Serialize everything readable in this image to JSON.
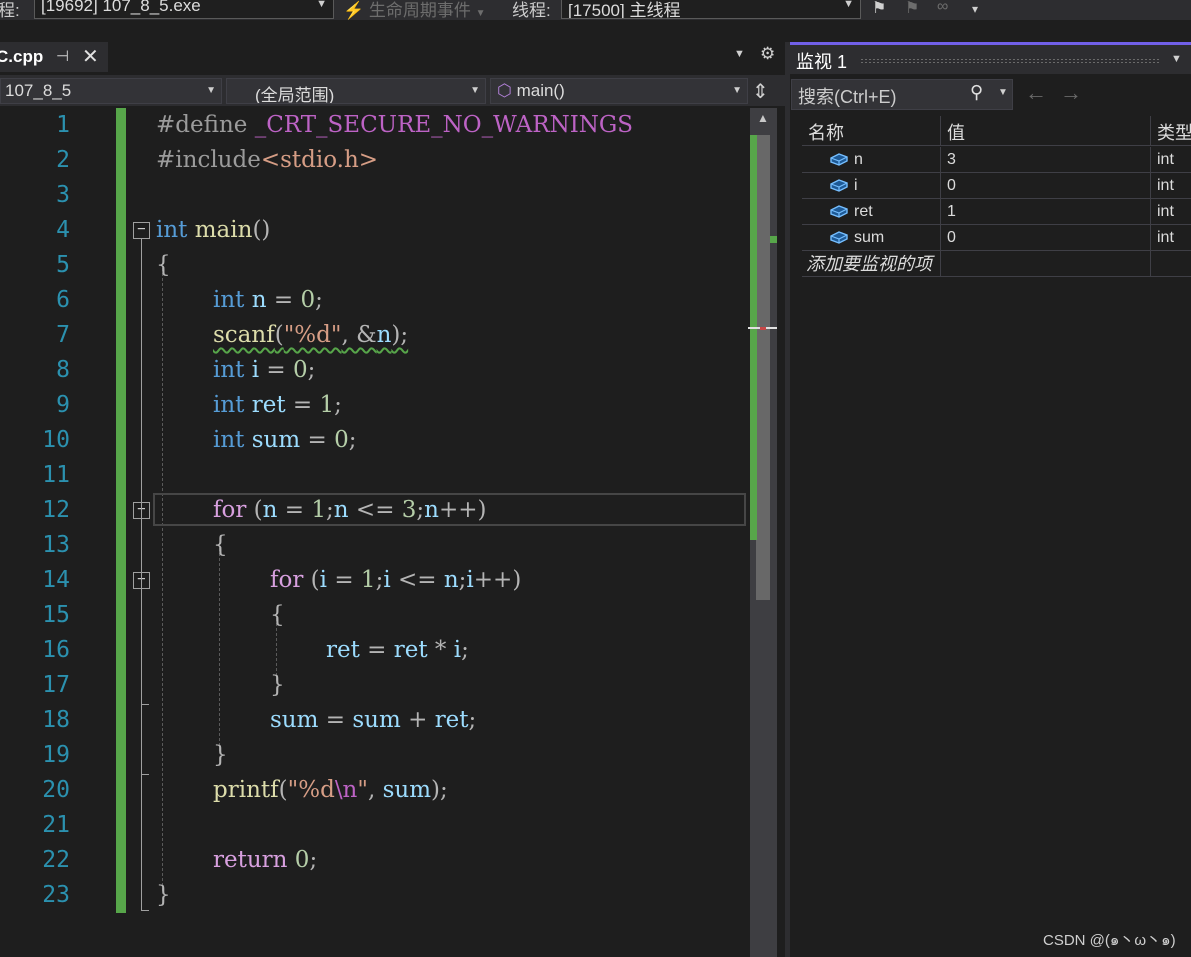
{
  "toolbar": {
    "process_label": "程:",
    "process_value": "[19692] 107_8_5.exe",
    "lifecycle_label": "生命周期事件",
    "thread_label": "线程:",
    "thread_value": "[17500] 主线程"
  },
  "editor": {
    "tab_name": "C.cpp",
    "project_scope": "107_8_5",
    "global_scope": "(全局范围)",
    "function_scope": "main()",
    "line_numbers": [
      "1",
      "2",
      "3",
      "4",
      "5",
      "6",
      "7",
      "8",
      "9",
      "10",
      "11",
      "12",
      "13",
      "14",
      "15",
      "16",
      "17",
      "18",
      "19",
      "20",
      "21",
      "22",
      "23"
    ],
    "lines": {
      "l1a": "#define ",
      "l1b": "_CRT_SECURE_NO_WARNINGS",
      "l2a": "#include",
      "l2b": "<stdio.h>",
      "l4a": "int",
      "l4b": " main",
      "l4c": "()",
      "l5": "{",
      "l6a": "int",
      "l6b": " n",
      "l6c": " = ",
      "l6d": "0",
      "l6e": ";",
      "l7a": "scanf",
      "l7b": "(",
      "l7c": "\"%d\"",
      "l7d": ", &",
      "l7e": "n",
      "l7f": ");",
      "l8a": "int",
      "l8b": " i",
      "l8c": " = ",
      "l8d": "0",
      "l8e": ";",
      "l9a": "int",
      "l9b": " ret",
      "l9c": " = ",
      "l9d": "1",
      "l9e": ";",
      "l10a": "int",
      "l10b": " sum",
      "l10c": " = ",
      "l10d": "0",
      "l10e": ";",
      "l12a": "for",
      "l12b": " (",
      "l12c": "n",
      "l12d": " = ",
      "l12e": "1",
      "l12f": ";",
      "l12g": "n",
      "l12h": " <= ",
      "l12i": "3",
      "l12j": ";",
      "l12k": "n",
      "l12l": "++)",
      "l13": "{",
      "l14a": "for",
      "l14b": " (",
      "l14c": "i",
      "l14d": " = ",
      "l14e": "1",
      "l14f": ";",
      "l14g": "i",
      "l14h": " <= ",
      "l14i": "n",
      "l14j": ";",
      "l14k": "i",
      "l14l": "++)",
      "l15": "{",
      "l16a": "ret",
      "l16b": " = ",
      "l16c": "ret",
      "l16d": " * ",
      "l16e": "i",
      "l16f": ";",
      "l17": "}",
      "l18a": "sum",
      "l18b": " = ",
      "l18c": "sum",
      "l18d": " + ",
      "l18e": "ret",
      "l18f": ";",
      "l19": "}",
      "l20a": "printf",
      "l20b": "(",
      "l20c": "\"%d",
      "l20d": "\\n",
      "l20e": "\"",
      "l20f": ", ",
      "l20g": "sum",
      "l20h": ");",
      "l22a": "return",
      "l22b": " ",
      "l22c": "0",
      "l22d": ";",
      "l23": "}"
    }
  },
  "watch": {
    "title": "监视 1",
    "search_placeholder": "搜索(Ctrl+E)",
    "columns": [
      "名称",
      "值",
      "类型"
    ],
    "rows": [
      {
        "name": "n",
        "value": "3",
        "type": "int"
      },
      {
        "name": "i",
        "value": "0",
        "type": "int"
      },
      {
        "name": "ret",
        "value": "1",
        "type": "int"
      },
      {
        "name": "sum",
        "value": "0",
        "type": "int"
      }
    ],
    "add_item": "添加要监视的项"
  },
  "watermark": "CSDN @(๑丶ω丶๑)",
  "icons": {
    "search": "search-icon",
    "variable": "variable-cube-icon",
    "back": "arrow-left-icon",
    "forward": "arrow-right-icon"
  }
}
